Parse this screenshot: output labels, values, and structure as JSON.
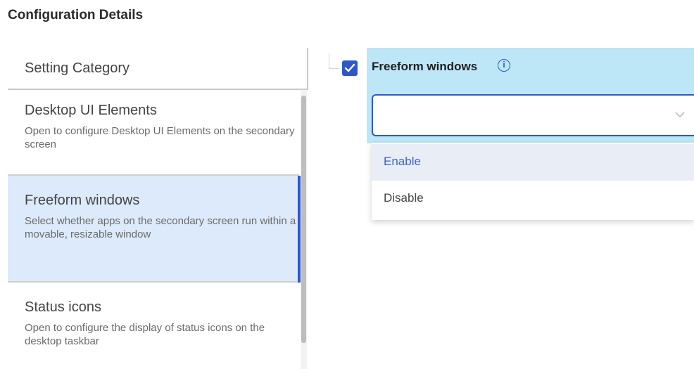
{
  "page": {
    "title": "Configuration Details"
  },
  "left_panel": {
    "header": "Setting Category",
    "categories": [
      {
        "title": "Desktop UI Elements",
        "description": "Open to configure Desktop UI Elements on the secondary screen",
        "selected": false
      },
      {
        "title": "Freeform windows",
        "description": "Select whether apps on the secondary screen run within a movable, resizable window",
        "selected": true
      },
      {
        "title": "Status icons",
        "description": "Open to configure the display of status icons on the desktop taskbar",
        "selected": false
      }
    ]
  },
  "setting": {
    "title": "Freeform windows",
    "checked": true,
    "select_value": "",
    "options": [
      "Enable",
      "Disable"
    ],
    "highlighted_option": "Enable"
  },
  "icons": {
    "checkbox": "checkmark-icon",
    "info": "info-icon",
    "chevron": "chevron-down-icon"
  },
  "colors": {
    "accent": "#2f57c9",
    "selected_category_bg": "#dceafb",
    "setting_header_bg": "#bde6f7",
    "highlighted_option_bg": "#e8edf6"
  }
}
